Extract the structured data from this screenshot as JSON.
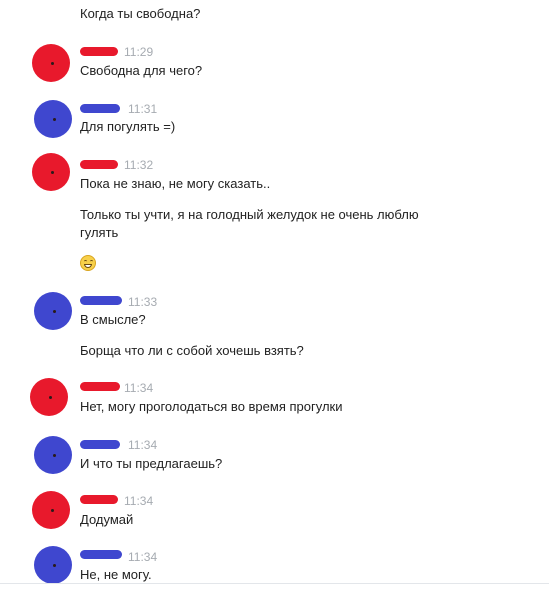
{
  "messages": {
    "m0": {
      "lines": [
        "Когда ты свободна?"
      ]
    },
    "m1": {
      "time": "11:29",
      "lines": [
        "Свободна для чего?"
      ]
    },
    "m2": {
      "time": "11:31",
      "lines": [
        "Для погулять =)"
      ]
    },
    "m3": {
      "time": "11:32",
      "lines": [
        "Пока не знаю, не могу сказать..",
        "Только ты учти, я на голодный желудок не очень люблю гулять"
      ],
      "emoji": "grinning-face-emoji"
    },
    "m4": {
      "time": "11:33",
      "lines": [
        "В смысле?",
        "Борща что ли с собой хочешь взять?"
      ]
    },
    "m5": {
      "time": "11:34",
      "lines": [
        "Нет, могу проголодаться во время прогулки"
      ]
    },
    "m6": {
      "time": "11:34",
      "lines": [
        "И что ты предлагаешь?"
      ]
    },
    "m7": {
      "time": "11:34",
      "lines": [
        "Додумай"
      ]
    },
    "m8": {
      "time": "11:34",
      "lines": [
        "Не, не могу."
      ]
    }
  },
  "colors": {
    "sender_red": "#e8192c",
    "sender_blue": "#3f47cf",
    "timestamp": "#a6abb1",
    "text": "#222222"
  }
}
